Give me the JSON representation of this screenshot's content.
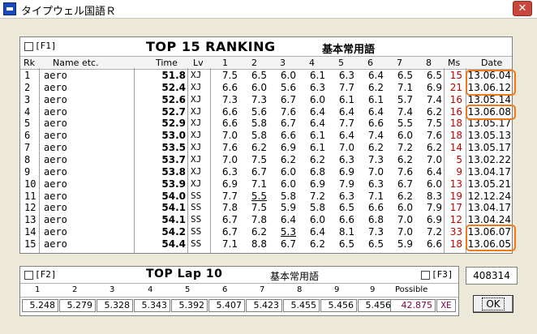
{
  "window": {
    "title": "タイプウェル国語Ｒ",
    "close": "✕"
  },
  "ranking": {
    "f1": "[F1]",
    "title": "TOP 15   RANKING",
    "subtitle": "基本常用語",
    "columns": [
      "Rk",
      "Name etc.",
      "Time",
      "Lv",
      "1",
      "2",
      "3",
      "4",
      "5",
      "6",
      "7",
      "8",
      "Ms",
      "Date"
    ],
    "rows": [
      {
        "rk": "1",
        "name": "aero",
        "time": "51.8",
        "lv": "XJ",
        "laps": [
          "7.5",
          "6.5",
          "6.0",
          "6.1",
          "6.3",
          "6.4",
          "6.5",
          "6.5"
        ],
        "ms": "15",
        "date": "13.06.04"
      },
      {
        "rk": "2",
        "name": "aero",
        "time": "52.4",
        "lv": "XJ",
        "laps": [
          "6.6",
          "6.0",
          "5.6",
          "6.3",
          "7.7",
          "6.2",
          "7.1",
          "6.9"
        ],
        "ms": "21",
        "date": "13.06.12"
      },
      {
        "rk": "3",
        "name": "aero",
        "time": "52.6",
        "lv": "XJ",
        "laps": [
          "7.3",
          "7.3",
          "6.7",
          "6.0",
          "6.1",
          "6.1",
          "5.7",
          "7.4"
        ],
        "ms": "16",
        "date": "13.05.14"
      },
      {
        "rk": "4",
        "name": "aero",
        "time": "52.7",
        "lv": "XJ",
        "laps": [
          "6.6",
          "5.6",
          "7.6",
          "6.4",
          "6.4",
          "6.4",
          "7.4",
          "6.2"
        ],
        "ms": "16",
        "date": "13.06.08"
      },
      {
        "rk": "5",
        "name": "aero",
        "time": "52.9",
        "lv": "XJ",
        "laps": [
          "6.6",
          "5.8",
          "6.7",
          "6.4",
          "7.7",
          "6.6",
          "5.5",
          "7.5"
        ],
        "ms": "18",
        "date": "13.05.17"
      },
      {
        "rk": "6",
        "name": "aero",
        "time": "53.0",
        "lv": "XJ",
        "laps": [
          "7.0",
          "5.8",
          "6.6",
          "6.1",
          "6.4",
          "7.4",
          "6.0",
          "7.6"
        ],
        "ms": "18",
        "date": "13.05.13"
      },
      {
        "rk": "7",
        "name": "aero",
        "time": "53.5",
        "lv": "XJ",
        "laps": [
          "7.6",
          "6.2",
          "6.9",
          "6.1",
          "7.0",
          "6.2",
          "7.2",
          "6.2"
        ],
        "ms": "14",
        "date": "13.05.17"
      },
      {
        "rk": "8",
        "name": "aero",
        "time": "53.7",
        "lv": "XJ",
        "laps": [
          "7.0",
          "7.5",
          "6.2",
          "6.2",
          "6.3",
          "7.3",
          "6.2",
          "7.0"
        ],
        "ms": "5",
        "date": "13.02.22"
      },
      {
        "rk": "9",
        "name": "aero",
        "time": "53.8",
        "lv": "XJ",
        "laps": [
          "6.3",
          "6.7",
          "6.0",
          "6.8",
          "6.9",
          "7.0",
          "7.6",
          "6.4"
        ],
        "ms": "9",
        "date": "13.04.17"
      },
      {
        "rk": "10",
        "name": "aero",
        "time": "53.9",
        "lv": "XJ",
        "laps": [
          "6.9",
          "7.1",
          "6.0",
          "6.9",
          "7.9",
          "6.3",
          "6.7",
          "6.0"
        ],
        "ms": "13",
        "date": "13.05.21"
      },
      {
        "rk": "11",
        "name": "aero",
        "time": "54.0",
        "lv": "SS",
        "laps": [
          "7.7",
          "5.5",
          "5.8",
          "7.2",
          "6.3",
          "7.1",
          "6.2",
          "8.3"
        ],
        "ms": "19",
        "date": "12.12.24"
      },
      {
        "rk": "12",
        "name": "aero",
        "time": "54.1",
        "lv": "SS",
        "laps": [
          "7.8",
          "7.5",
          "5.9",
          "5.8",
          "6.5",
          "6.6",
          "6.0",
          "7.9"
        ],
        "ms": "17",
        "date": "13.04.17"
      },
      {
        "rk": "13",
        "name": "aero",
        "time": "54.1",
        "lv": "SS",
        "laps": [
          "6.7",
          "7.8",
          "6.4",
          "6.0",
          "6.6",
          "6.8",
          "7.0",
          "6.9"
        ],
        "ms": "12",
        "date": "13.04.24"
      },
      {
        "rk": "14",
        "name": "aero",
        "time": "54.2",
        "lv": "SS",
        "laps": [
          "6.7",
          "6.2",
          "5.3",
          "6.4",
          "8.1",
          "7.3",
          "7.0",
          "7.2"
        ],
        "ms": "33",
        "date": "13.06.07"
      },
      {
        "rk": "15",
        "name": "aero",
        "time": "54.4",
        "lv": "SS",
        "laps": [
          "7.1",
          "8.8",
          "6.7",
          "6.2",
          "6.5",
          "6.5",
          "5.9",
          "6.6"
        ],
        "ms": "18",
        "date": "13.06.05"
      }
    ]
  },
  "lap": {
    "f2": "[F2]",
    "title": "TOP Lap 10",
    "subtitle": "基本常用語",
    "f3": "[F3]",
    "columns": [
      "1",
      "2",
      "3",
      "4",
      "5",
      "6",
      "7",
      "8",
      "9",
      "9",
      "Possible"
    ],
    "values": [
      "5.248",
      "5.279",
      "5.328",
      "5.343",
      "5.392",
      "5.407",
      "5.423",
      "5.455",
      "5.456",
      "5.456"
    ],
    "possible": "42.875",
    "possible_level": "XE"
  },
  "score": "408314",
  "ok_label": "OK",
  "colors": {
    "ms_red": "#c00000",
    "highlight": "#f07a1a",
    "possible_purple": "#800040"
  }
}
